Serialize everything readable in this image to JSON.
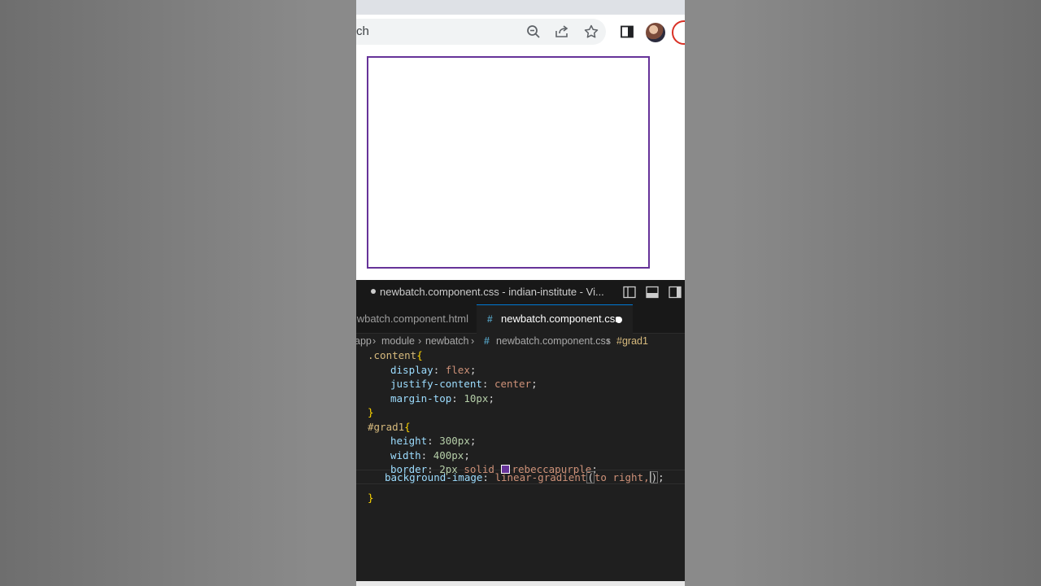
{
  "browser": {
    "omnibox_text": "ch",
    "icons": [
      "zoom-out-icon",
      "share-icon",
      "star-icon",
      "side-panel-icon",
      "profile-avatar",
      "profile-button"
    ]
  },
  "preview": {
    "box_border_color": "#663399"
  },
  "vscode": {
    "window_title": "newbatch.component.css - indian-institute - Vi...",
    "tabs": [
      {
        "label": "wbatch.component.html",
        "active": false
      },
      {
        "label": "newbatch.component.css",
        "active": true,
        "dirty": true
      }
    ],
    "breadcrumb": {
      "seg0": "app",
      "seg1": "module",
      "seg2": "newbatch",
      "seg3_hash": "#",
      "seg3": "newbatch.component.css",
      "seg4": "#grad1"
    },
    "code": {
      "l1_sel": ".content",
      "l1_brace": "{",
      "l2_prop": "display",
      "l2_val": "flex",
      "l3_prop": "justify-content",
      "l3_val": "center",
      "l4_prop": "margin-top",
      "l4_val": "10px",
      "l5_brace": "}",
      "l6_sel": "#grad1",
      "l6_brace": "{",
      "l7_prop": "height",
      "l7_val": "300px",
      "l8_prop": "width",
      "l8_val": "400px",
      "l9_prop": "border",
      "l9_num": "2px",
      "l9_kw": "solid",
      "l9_color": "rebeccapurple",
      "l10_prop": "background-image",
      "l10_fn": "linear-gradient",
      "l10_open": "(",
      "l10_args": "to right,",
      "l10_close": ")",
      "l10_end": ";",
      "l11_brace": "}"
    }
  }
}
